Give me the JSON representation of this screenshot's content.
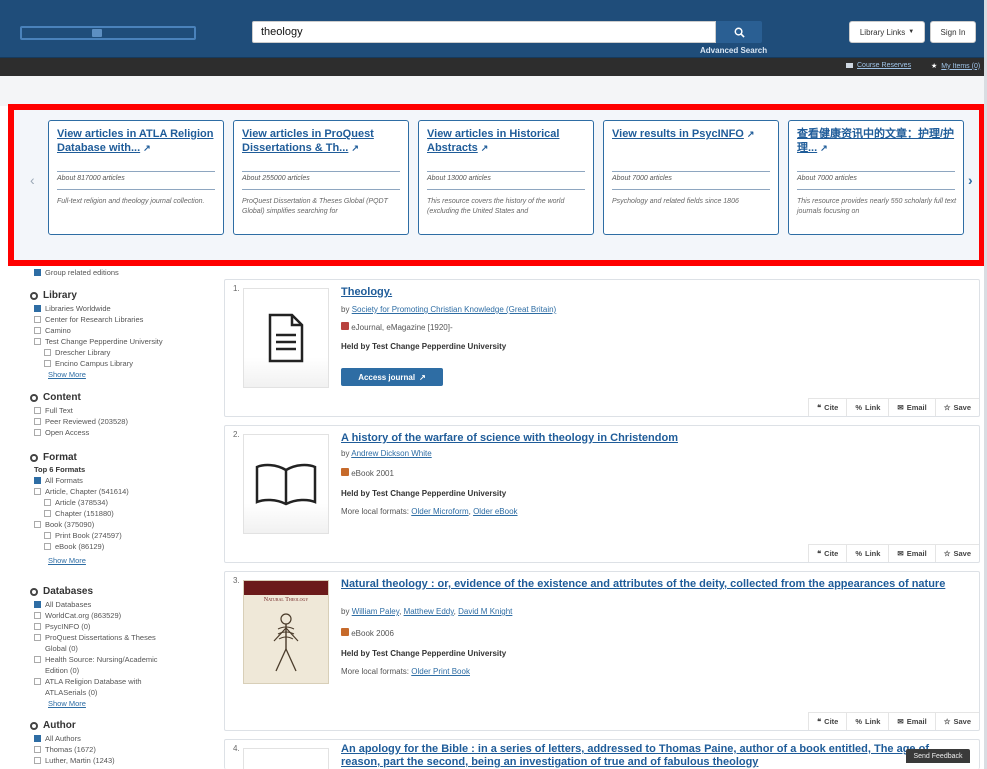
{
  "header": {
    "search_value": "theology",
    "advanced_search": "Advanced Search",
    "library_links": "Library Links",
    "sign_in": "Sign In",
    "course_reserves": "Course Reserves",
    "my_items": "My Items (0)"
  },
  "carousel": {
    "cards": [
      {
        "title": "View articles in ATLA Religion Database with...",
        "count": "About 817000 articles",
        "desc": "Full-text religion and theology journal collection."
      },
      {
        "title": "View articles in ProQuest Dissertations & Th...",
        "count": "About 255000 articles",
        "desc": "ProQuest Dissertation & Theses Global (PQDT Global) simplifies searching for"
      },
      {
        "title": "View articles in Historical Abstracts",
        "count": "About 13000 articles",
        "desc": "This resource covers the history of the world (excluding the United States and"
      },
      {
        "title": "View results in PsycINFO",
        "count": "About 7000 articles",
        "desc": "Psychology and related fields since 1806"
      },
      {
        "title": "查看健康资讯中的文章：护理/护理...",
        "count": "About 7000 articles",
        "desc": "This resource provides nearly 550 scholarly full text journals focusing on"
      }
    ]
  },
  "sidebar": {
    "group_related": "Group related editions",
    "library": {
      "heading": "Library",
      "items": [
        "Libraries Worldwide",
        "Center for Research Libraries",
        "Camino",
        "Test Change Pepperdine University",
        "Drescher Library",
        "Encino Campus Library"
      ],
      "show_more": "Show More"
    },
    "content": {
      "heading": "Content",
      "items": [
        "Full Text",
        "Peer Reviewed (203528)",
        "Open Access"
      ]
    },
    "format": {
      "heading": "Format",
      "top": "Top 6 Formats",
      "items": [
        "All Formats",
        "Article, Chapter (541614)",
        "Article (378534)",
        "Chapter (151880)",
        "Book (375090)",
        "Print Book (274597)",
        "eBook (86129)"
      ],
      "show_more": "Show More"
    },
    "databases": {
      "heading": "Databases",
      "items": [
        "All Databases",
        "WorldCat.org (863529)",
        "PsycINFO (0)",
        "ProQuest Dissertations & Theses",
        "Global (0)",
        "Health Source: Nursing/Academic",
        "Edition (0)",
        "ATLA Religion Database with",
        "ATLASerials (0)"
      ],
      "show_more": "Show More"
    },
    "author": {
      "heading": "Author",
      "items": [
        "All Authors",
        "Thomas (1672)",
        "Luther, Martin (1243)"
      ]
    }
  },
  "results": [
    {
      "num": "1.",
      "title": "Theology.",
      "by": "by",
      "author": "Society for Promoting Christian Knowledge (Great Britain)",
      "format": "eJournal, eMagazine [1920]-",
      "held": "Held by Test Change Pepperdine University",
      "button": "Access journal"
    },
    {
      "num": "2.",
      "title": "A history of the warfare of science with theology in Christendom",
      "by": "by",
      "author": "Andrew Dickson White",
      "format": "eBook 2001",
      "held": "Held by Test Change Pepperdine University",
      "more_label": "More local formats:",
      "more_links": [
        "Older Microform",
        "Older eBook"
      ]
    },
    {
      "num": "3.",
      "title": "Natural theology : or, evidence of the existence and attributes of the deity, collected from the appearances of nature",
      "by": "by",
      "authors": [
        "William Paley",
        "Matthew Eddy",
        "David M Knight"
      ],
      "format": "eBook 2006",
      "held": "Held by Test Change Pepperdine University",
      "more_label": "More local formats:",
      "more_links": [
        "Older Print Book"
      ],
      "cover_title": "Natural Theology"
    },
    {
      "num": "4.",
      "title": "An apology for the Bible : in a series of letters, addressed to Thomas Paine, author of a book entitled, The age of reason, part the second, being an investigation of true and of fabulous theology"
    }
  ],
  "actions": {
    "cite": "Cite",
    "link": "Link",
    "email": "Email",
    "save": "Save"
  },
  "feedback": "Send Feedback"
}
